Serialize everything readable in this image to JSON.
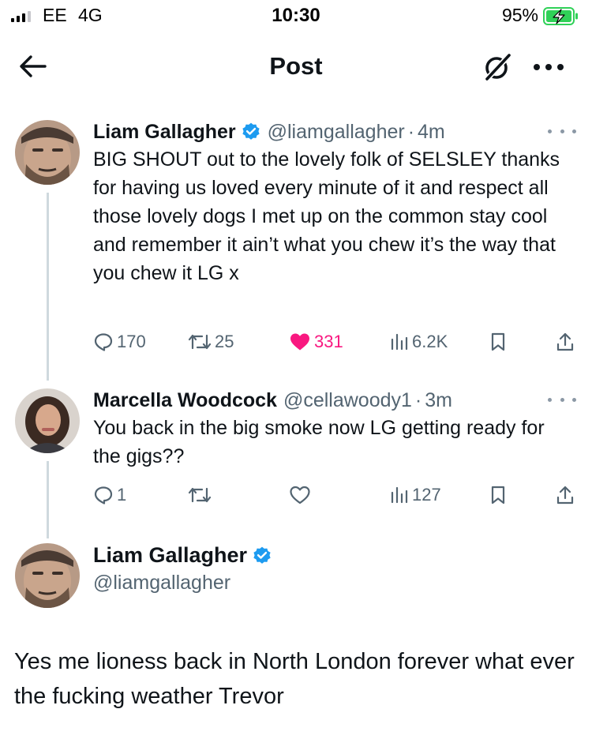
{
  "status_bar": {
    "carrier": "EE",
    "network": "4G",
    "time": "10:30",
    "battery": "95%"
  },
  "header": {
    "title": "Post",
    "back_icon": "arrow-left-icon",
    "grok_icon": "grok-icon",
    "more_icon": "more-horizontal-icon"
  },
  "colors": {
    "verified": "#1d9bf0",
    "like": "#f91880",
    "muted": "#536471",
    "thread_line": "#cfd9de"
  },
  "thread": [
    {
      "name": "Liam Gallagher",
      "verified": true,
      "handle": "@liamgallagher",
      "time": "4m",
      "text": "BIG SHOUT out to the lovely folk of SELSLEY thanks for having us loved every minute of it and respect all those lovely dogs I met up on the common stay cool and remember it ain’t what you chew it’s the way that you chew it LG x",
      "actions": {
        "replies": "170",
        "reposts": "25",
        "likes": "331",
        "liked": true,
        "views": "6.2K"
      }
    },
    {
      "name": "Marcella Woodcock",
      "verified": false,
      "handle": "@cellawoody1",
      "time": "3m",
      "text": "You back in the big smoke now LG getting ready for the gigs??",
      "actions": {
        "replies": "1",
        "reposts": "",
        "likes": "",
        "liked": false,
        "views": "127"
      }
    }
  ],
  "focused": {
    "name": "Liam Gallagher",
    "verified": true,
    "handle": "@liamgallagher",
    "text": "Yes me lioness back in North London forever what ever the fucking weather Trevor"
  }
}
